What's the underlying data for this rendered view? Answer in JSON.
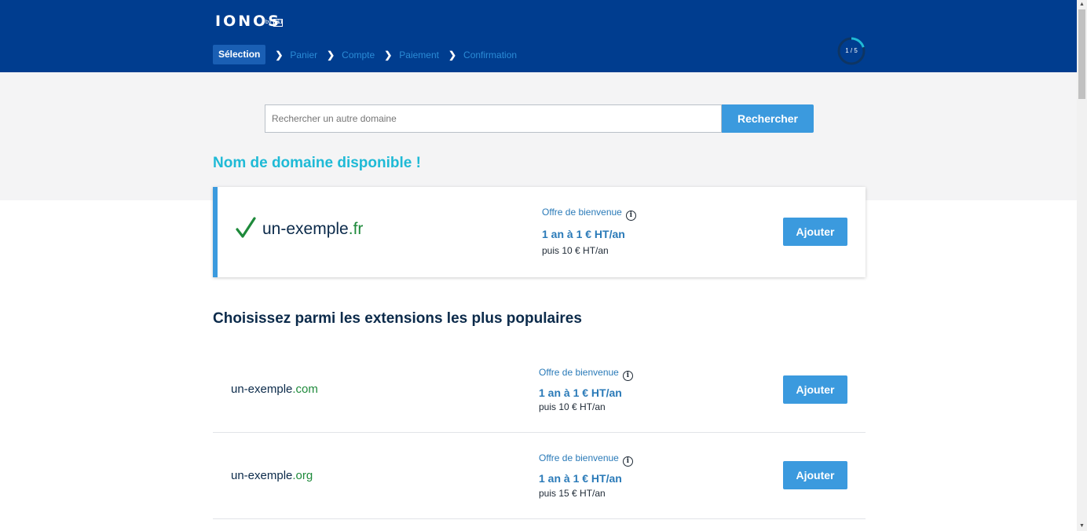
{
  "header": {
    "logo": "IONOS",
    "logo_by": "by",
    "logo_badge": "1&1",
    "steps": [
      "Sélection",
      "Panier",
      "Compte",
      "Paiement",
      "Confirmation"
    ],
    "progress_text": "1 / 5",
    "progress_fraction": 0.2
  },
  "search": {
    "placeholder": "Rechercher un autre domaine",
    "button": "Rechercher"
  },
  "available": {
    "title": "Nom de domaine disponible !",
    "domain_name": "un-exemple",
    "domain_ext": ".fr",
    "offer_label": "Offre de bienvenue",
    "price": "1 an à 1 € HT/an",
    "then": "puis 10 € HT/an",
    "button": "Ajouter"
  },
  "popular": {
    "title": "Choisissez parmi les extensions les plus populaires",
    "rows": [
      {
        "domain_name": "un-exemple",
        "domain_ext": ".com",
        "offer_label": "Offre de bienvenue",
        "price": "1 an à 1 € HT/an",
        "then": "puis 10 € HT/an",
        "button": "Ajouter"
      },
      {
        "domain_name": "un-exemple",
        "domain_ext": ".org",
        "offer_label": "Offre de bienvenue",
        "price": "1 an à 1 € HT/an",
        "then": "puis 15 € HT/an",
        "button": "Ajouter"
      }
    ]
  },
  "icons": {
    "info": "i",
    "chevron": "❯",
    "check": "check-icon"
  },
  "colors": {
    "header_bg": "#003d8f",
    "accent": "#3b9ade",
    "available_title": "#1fbad6",
    "extension_green": "#1e8a3b"
  }
}
